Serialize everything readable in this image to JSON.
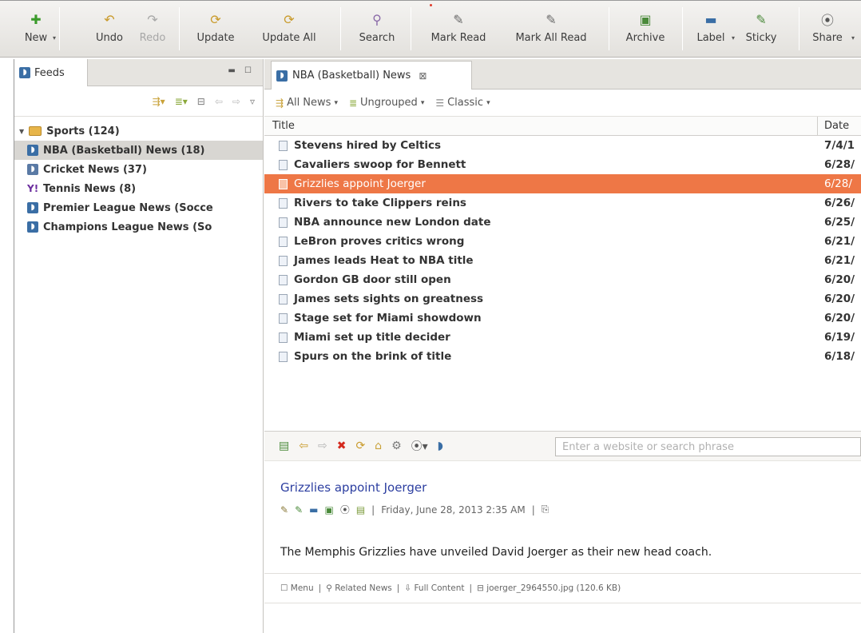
{
  "toolbar": {
    "buttons": [
      {
        "label": "New",
        "icon": "plus-icon"
      },
      {
        "label": "Undo",
        "icon": "undo-icon"
      },
      {
        "label": "Redo",
        "icon": "redo-icon"
      },
      {
        "label": "Update",
        "icon": "update-icon"
      },
      {
        "label": "Update All",
        "icon": "update-all-icon"
      },
      {
        "label": "Search",
        "icon": "search-icon"
      },
      {
        "label": "Mark Read",
        "icon": "mark-read-icon"
      },
      {
        "label": "Mark All Read",
        "icon": "mark-all-read-icon"
      },
      {
        "label": "Archive",
        "icon": "archive-icon"
      },
      {
        "label": "Label",
        "icon": "label-icon"
      },
      {
        "label": "Sticky",
        "icon": "sticky-icon"
      },
      {
        "label": "Share",
        "icon": "share-icon"
      }
    ]
  },
  "left_panel": {
    "tab_label": "Feeds",
    "tree": {
      "root": "Sports (124)",
      "children": [
        "NBA (Basketball) News (18)",
        "Cricket News (37)",
        "Tennis News (8)",
        "Premier League News (Socce",
        "Champions League News (So"
      ]
    }
  },
  "right_panel": {
    "tab_label": "NBA (Basketball) News",
    "view_bar": {
      "filter": "All News",
      "grouping": "Ungrouped",
      "layout": "Classic"
    },
    "columns": {
      "title": "Title",
      "date": "Date"
    },
    "news": [
      {
        "title": "Stevens hired by Celtics",
        "date": "7/4/1"
      },
      {
        "title": "Cavaliers swoop for Bennett",
        "date": "6/28/"
      },
      {
        "title": "Grizzlies appoint Joerger",
        "date": "6/28/"
      },
      {
        "title": "Rivers to take Clippers reins",
        "date": "6/26/"
      },
      {
        "title": "NBA announce new London date",
        "date": "6/25/"
      },
      {
        "title": "LeBron proves critics wrong",
        "date": "6/21/"
      },
      {
        "title": "James leads Heat to NBA title",
        "date": "6/21/"
      },
      {
        "title": "Gordon GB door still open",
        "date": "6/20/"
      },
      {
        "title": "James sets sights on greatness",
        "date": "6/20/"
      },
      {
        "title": "Stage set for Miami showdown",
        "date": "6/20/"
      },
      {
        "title": "Miami set up title decider",
        "date": "6/19/"
      },
      {
        "title": "Spurs on the brink of title",
        "date": "6/18/"
      }
    ],
    "browser": {
      "search_placeholder": "Enter a website or search phrase"
    },
    "article": {
      "title": "Grizzlies appoint Joerger",
      "date": "Friday, June 28, 2013 2:35 AM",
      "separator": "|",
      "body": "The Memphis Grizzlies have unveiled David Joerger as their new head coach.",
      "footer": {
        "menu": "Menu",
        "related": "Related News",
        "full": "Full Content",
        "attachment": "joerger_2964550.jpg (120.6 KB)"
      }
    }
  },
  "colors": {
    "selection": "#ee7746",
    "tree_selection": "#d8d6d2",
    "link": "#2c3ea0"
  }
}
